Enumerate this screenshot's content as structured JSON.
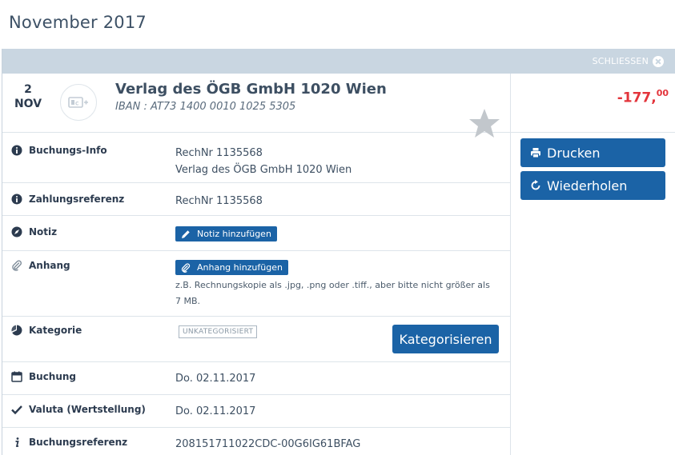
{
  "page": {
    "month_title": "November 2017"
  },
  "panel": {
    "close_label": "SCHLIESSEN"
  },
  "transaction": {
    "day": "2",
    "month": "NOV",
    "merchant": "Verlag des ÖGB GmbH 1020 Wien",
    "iban": "IBAN : AT73 1400 0010 1025 5305",
    "amount_main": "-177,",
    "amount_cents": "00",
    "favorite": false
  },
  "colors": {
    "accent": "#1b63a6",
    "negative": "#e3343b",
    "topbar": "#c9d6e1"
  },
  "details": {
    "buchungs_info": {
      "label": "Buchungs-Info",
      "line1": "RechNr 1135568",
      "line2": "Verlag des ÖGB GmbH 1020 Wien"
    },
    "zahlungsreferenz": {
      "label": "Zahlungsreferenz",
      "value": "RechNr 1135568"
    },
    "notiz": {
      "label": "Notiz",
      "button": "Notiz hinzufügen"
    },
    "anhang": {
      "label": "Anhang",
      "button": "Anhang hinzufügen",
      "hint": "z.B. Rechnungskopie als .jpg, .png oder .tiff., aber bitte nicht größer als 7 MB."
    },
    "kategorie": {
      "label": "Kategorie",
      "badge": "UNKATEGORISIERT",
      "button": "Kategorisieren"
    },
    "buchung": {
      "label": "Buchung",
      "value": "Do. 02.11.2017"
    },
    "valuta": {
      "label": "Valuta (Wertstellung)",
      "value": "Do. 02.11.2017"
    },
    "buchungsreferenz": {
      "label": "Buchungsreferenz",
      "value": "208151711022CDC-00G6IG61BFAG"
    }
  },
  "actions": {
    "print_label": "Drucken",
    "repeat_label": "Wiederholen"
  }
}
